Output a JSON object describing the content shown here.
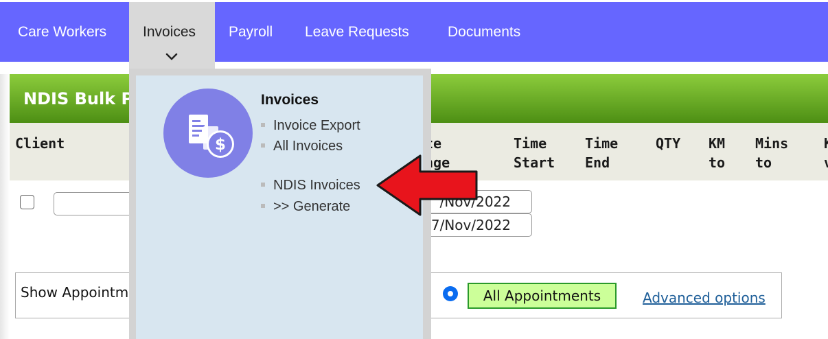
{
  "nav": {
    "items": [
      {
        "label": "Care Workers"
      },
      {
        "label": "Invoices"
      },
      {
        "label": "Payroll"
      },
      {
        "label": "Leave Requests"
      },
      {
        "label": "Documents"
      }
    ]
  },
  "page": {
    "title": "NDIS Bulk Pa"
  },
  "table": {
    "headers": [
      {
        "label": "Client"
      },
      {
        "label": "te\nnge"
      },
      {
        "label": "Time\nStart"
      },
      {
        "label": "Time\nEnd"
      },
      {
        "label": "QTY"
      },
      {
        "label": "KM\nto"
      },
      {
        "label": "Mins\nto"
      },
      {
        "label": "K\nv"
      }
    ],
    "row": {
      "date_start": "/Nov/2022",
      "date_end": "7/Nov/2022"
    }
  },
  "filter": {
    "show_label": "Show Appointm",
    "all_appointments": "All Appointments",
    "advanced_options": "Advanced options"
  },
  "dropdown": {
    "title": "Invoices",
    "items": [
      {
        "label": "Invoice Export"
      },
      {
        "label": "All Invoices"
      },
      {
        "label": "NDIS Invoices"
      },
      {
        "label": ">> Generate"
      }
    ]
  },
  "colors": {
    "nav_bg": "#6666ff",
    "header_green": "#5aa01e",
    "dropdown_bg": "#d8e6f0",
    "arrow": "#e8141c"
  },
  "icons": [
    "chevron-down-icon",
    "invoice-dollar-icon",
    "red-arrow-icon"
  ]
}
